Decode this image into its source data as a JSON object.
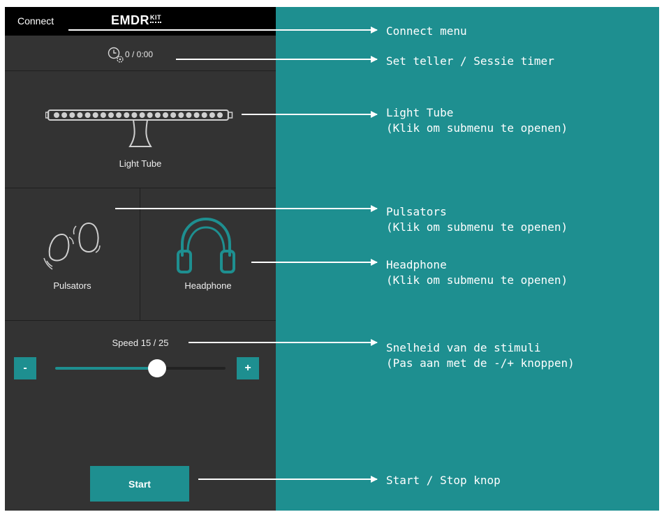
{
  "app": {
    "connect_label": "Connect",
    "logo_main": "EMDR",
    "logo_kit": "KIT"
  },
  "timer": {
    "text": "0 / 0:00",
    "icon": "clock-gear-icon"
  },
  "devices": {
    "light_tube": "Light Tube",
    "pulsators": "Pulsators",
    "headphone": "Headphone"
  },
  "speed": {
    "label": "Speed 15 / 25",
    "value": 15,
    "max": 25,
    "minus_label": "-",
    "plus_label": "+"
  },
  "start": {
    "label": "Start"
  },
  "annotations": {
    "connect": [
      "Connect menu"
    ],
    "timer": [
      "Set teller / Sessie timer"
    ],
    "light_tube": [
      "Light Tube",
      "(Klik om submenu te openen)"
    ],
    "pulsators": [
      "Pulsators",
      "(Klik om submenu te openen)"
    ],
    "headphone": [
      "Headphone",
      "(Klik om submenu te openen)"
    ],
    "speed": [
      "Snelheid van de stimuli",
      "(Pas aan met de -/+ knoppen)"
    ],
    "start": [
      "Start / Stop knop"
    ]
  },
  "colors": {
    "teal": "#1e8f90",
    "panel": "#333333",
    "topbar": "#000000"
  }
}
